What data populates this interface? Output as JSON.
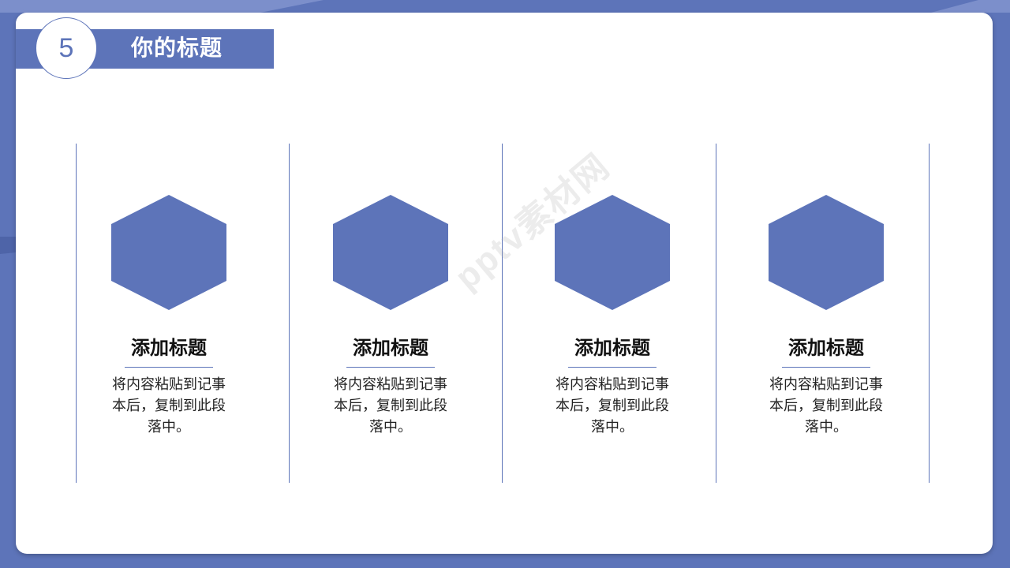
{
  "header": {
    "number": "5",
    "title": "你的标题"
  },
  "columns": [
    {
      "title": "添加标题",
      "text": "将内容粘贴到记事本后，复制到此段落中。"
    },
    {
      "title": "添加标题",
      "text": "将内容粘贴到记事本后，复制到此段落中。"
    },
    {
      "title": "添加标题",
      "text": "将内容粘贴到记事本后，复制到此段落中。"
    },
    {
      "title": "添加标题",
      "text": "将内容粘贴到记事本后，复制到此段落中。"
    }
  ],
  "watermark": "pptv素材网",
  "colors": {
    "accent": "#5d74b9",
    "background": "#ffffff",
    "title_text": "#111111",
    "body_text": "#222222"
  }
}
